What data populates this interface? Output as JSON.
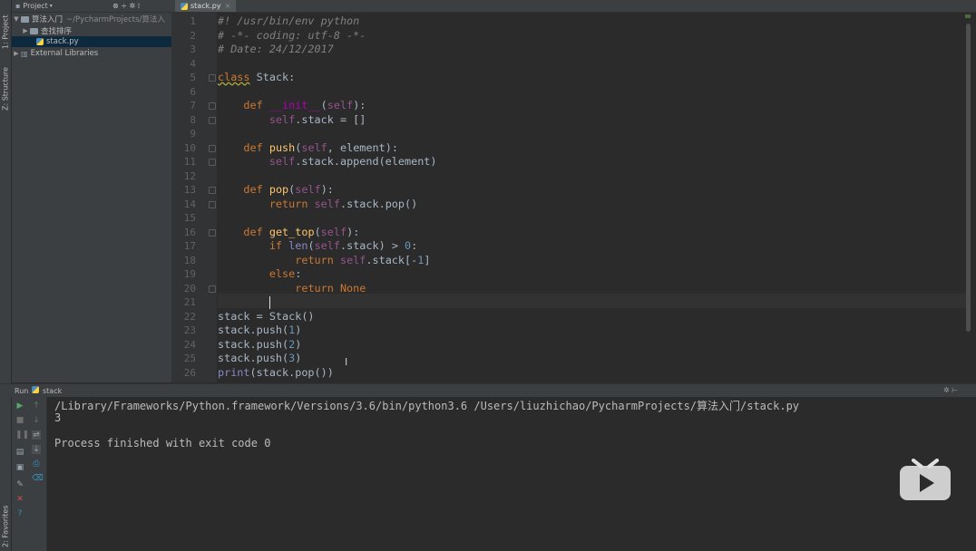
{
  "left_strip": {
    "tabs": [
      "1: Project",
      "Z: Structure",
      "2: Favorites"
    ]
  },
  "project_panel": {
    "header": "Project",
    "tree": [
      {
        "label": "算法入门",
        "path": "~/PycharmProjects/算法入",
        "level": 0,
        "expanded": true,
        "type": "folder"
      },
      {
        "label": "查找排序",
        "level": 1,
        "expanded": false,
        "type": "folder"
      },
      {
        "label": "stack.py",
        "level": 1,
        "type": "python-file",
        "selected": true
      },
      {
        "label": "External Libraries",
        "level": 0,
        "expanded": false,
        "type": "library"
      }
    ]
  },
  "editor": {
    "tab_label": "stack.py",
    "line_numbers": [
      "1",
      "2",
      "3",
      "4",
      "5",
      "6",
      "7",
      "8",
      "9",
      "10",
      "11",
      "12",
      "13",
      "14",
      "15",
      "16",
      "17",
      "18",
      "19",
      "20",
      "21",
      "22",
      "23",
      "24",
      "25",
      "26"
    ],
    "current_line": 21
  },
  "run_panel": {
    "title": "Run",
    "config": "stack",
    "output": [
      "/Library/Frameworks/Python.framework/Versions/3.6/bin/python3.6 /Users/liuzhichao/PycharmProjects/算法入门/stack.py",
      "3",
      "",
      "Process finished with exit code 0"
    ]
  },
  "colors": {
    "keyword": "#cc7832",
    "comment": "#808080",
    "function": "#ffc66d",
    "self": "#94558d",
    "number": "#6897bb",
    "builtin": "#8888c6"
  }
}
